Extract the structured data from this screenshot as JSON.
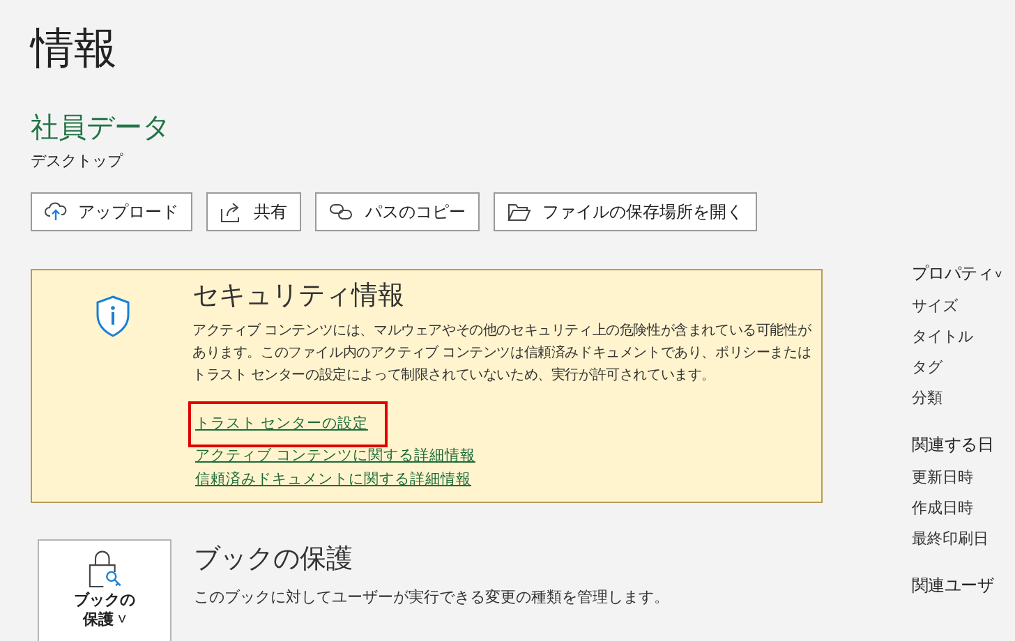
{
  "page_title": "情報",
  "document": {
    "name": "社員データ",
    "location": "デスクトップ"
  },
  "actions": [
    {
      "label": "アップロード",
      "kind": "upload"
    },
    {
      "label": "共有",
      "kind": "share"
    },
    {
      "label": "パスのコピー",
      "kind": "link"
    },
    {
      "label": "ファイルの保存場所を開く",
      "kind": "folder"
    }
  ],
  "security": {
    "title": "セキュリティ情報",
    "description": "アクティブ コンテンツには、マルウェアやその他のセキュリティ上の危険性が含まれている可能性があります。このファイル内のアクティブ コンテンツは信頼済みドキュメントであり、ポリシーまたはトラスト センターの設定によって制限されていないため、実行が許可されています。",
    "links": [
      {
        "label": "トラスト センターの設定",
        "highlighted": true
      },
      {
        "label": "アクティブ コンテンツに関する詳細情報",
        "highlighted": false
      },
      {
        "label": "信頼済みドキュメントに関する詳細情報",
        "highlighted": false
      }
    ]
  },
  "protect": {
    "button": [
      "ブックの",
      "保護"
    ],
    "caret": "˅",
    "title": "ブックの保護",
    "description": "このブックに対してユーザーが実行できる変更の種類を管理します。"
  },
  "properties": {
    "heading": "プロパティ",
    "caret": "˅",
    "items": [
      "サイズ",
      "タイトル",
      "タグ",
      "分類"
    ]
  },
  "dates": {
    "heading": "関連する日",
    "items": [
      "更新日時",
      "作成日時",
      "最終印刷日"
    ]
  },
  "people": {
    "heading": "関連ユーザ"
  }
}
